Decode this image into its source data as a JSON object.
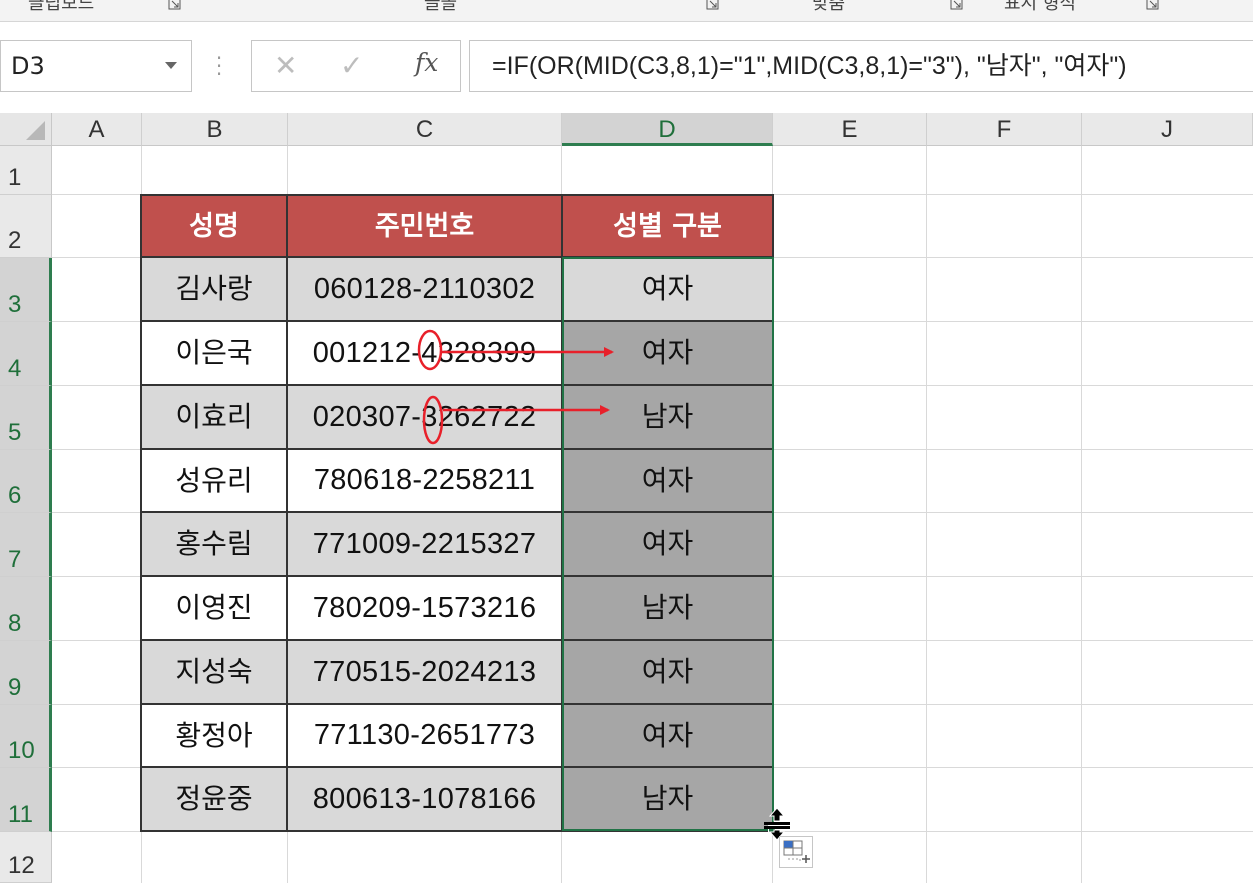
{
  "ribbon": {
    "groups": [
      "클립보드",
      "글꼴",
      "맞춤",
      "표시 형식"
    ]
  },
  "formula_bar": {
    "name_box": "D3",
    "cancel_icon": "✕",
    "enter_icon": "✓",
    "fx_label": "fx",
    "formula": "=IF(OR(MID(C3,8,1)=\"1\",MID(C3,8,1)=\"3\"), \"남자\", \"여자\")"
  },
  "columns": [
    "A",
    "B",
    "C",
    "D",
    "E",
    "F",
    "J"
  ],
  "rows": [
    "1",
    "2",
    "3",
    "4",
    "5",
    "6",
    "7",
    "8",
    "9",
    "10",
    "11",
    "12"
  ],
  "table": {
    "headers": [
      "성명",
      "주민번호",
      "성별 구분"
    ],
    "rows": [
      {
        "name": "김사랑",
        "id": "060128-2110302",
        "gender": "여자"
      },
      {
        "name": "이은국",
        "id": "001212-4328399",
        "gender": "여자"
      },
      {
        "name": "이효리",
        "id": "020307-3262722",
        "gender": "남자"
      },
      {
        "name": "성유리",
        "id": "780618-2258211",
        "gender": "여자"
      },
      {
        "name": "홍수림",
        "id": "771009-2215327",
        "gender": "여자"
      },
      {
        "name": "이영진",
        "id": "780209-1573216",
        "gender": "남자"
      },
      {
        "name": "지성숙",
        "id": "770515-2024213",
        "gender": "여자"
      },
      {
        "name": "황정아",
        "id": "771130-2651773",
        "gender": "여자"
      },
      {
        "name": "정윤중",
        "id": "800613-1078166",
        "gender": "남자"
      }
    ]
  },
  "colors": {
    "header_fill": "#c0504d",
    "selection_border": "#217346",
    "annotation": "#e8202a"
  }
}
